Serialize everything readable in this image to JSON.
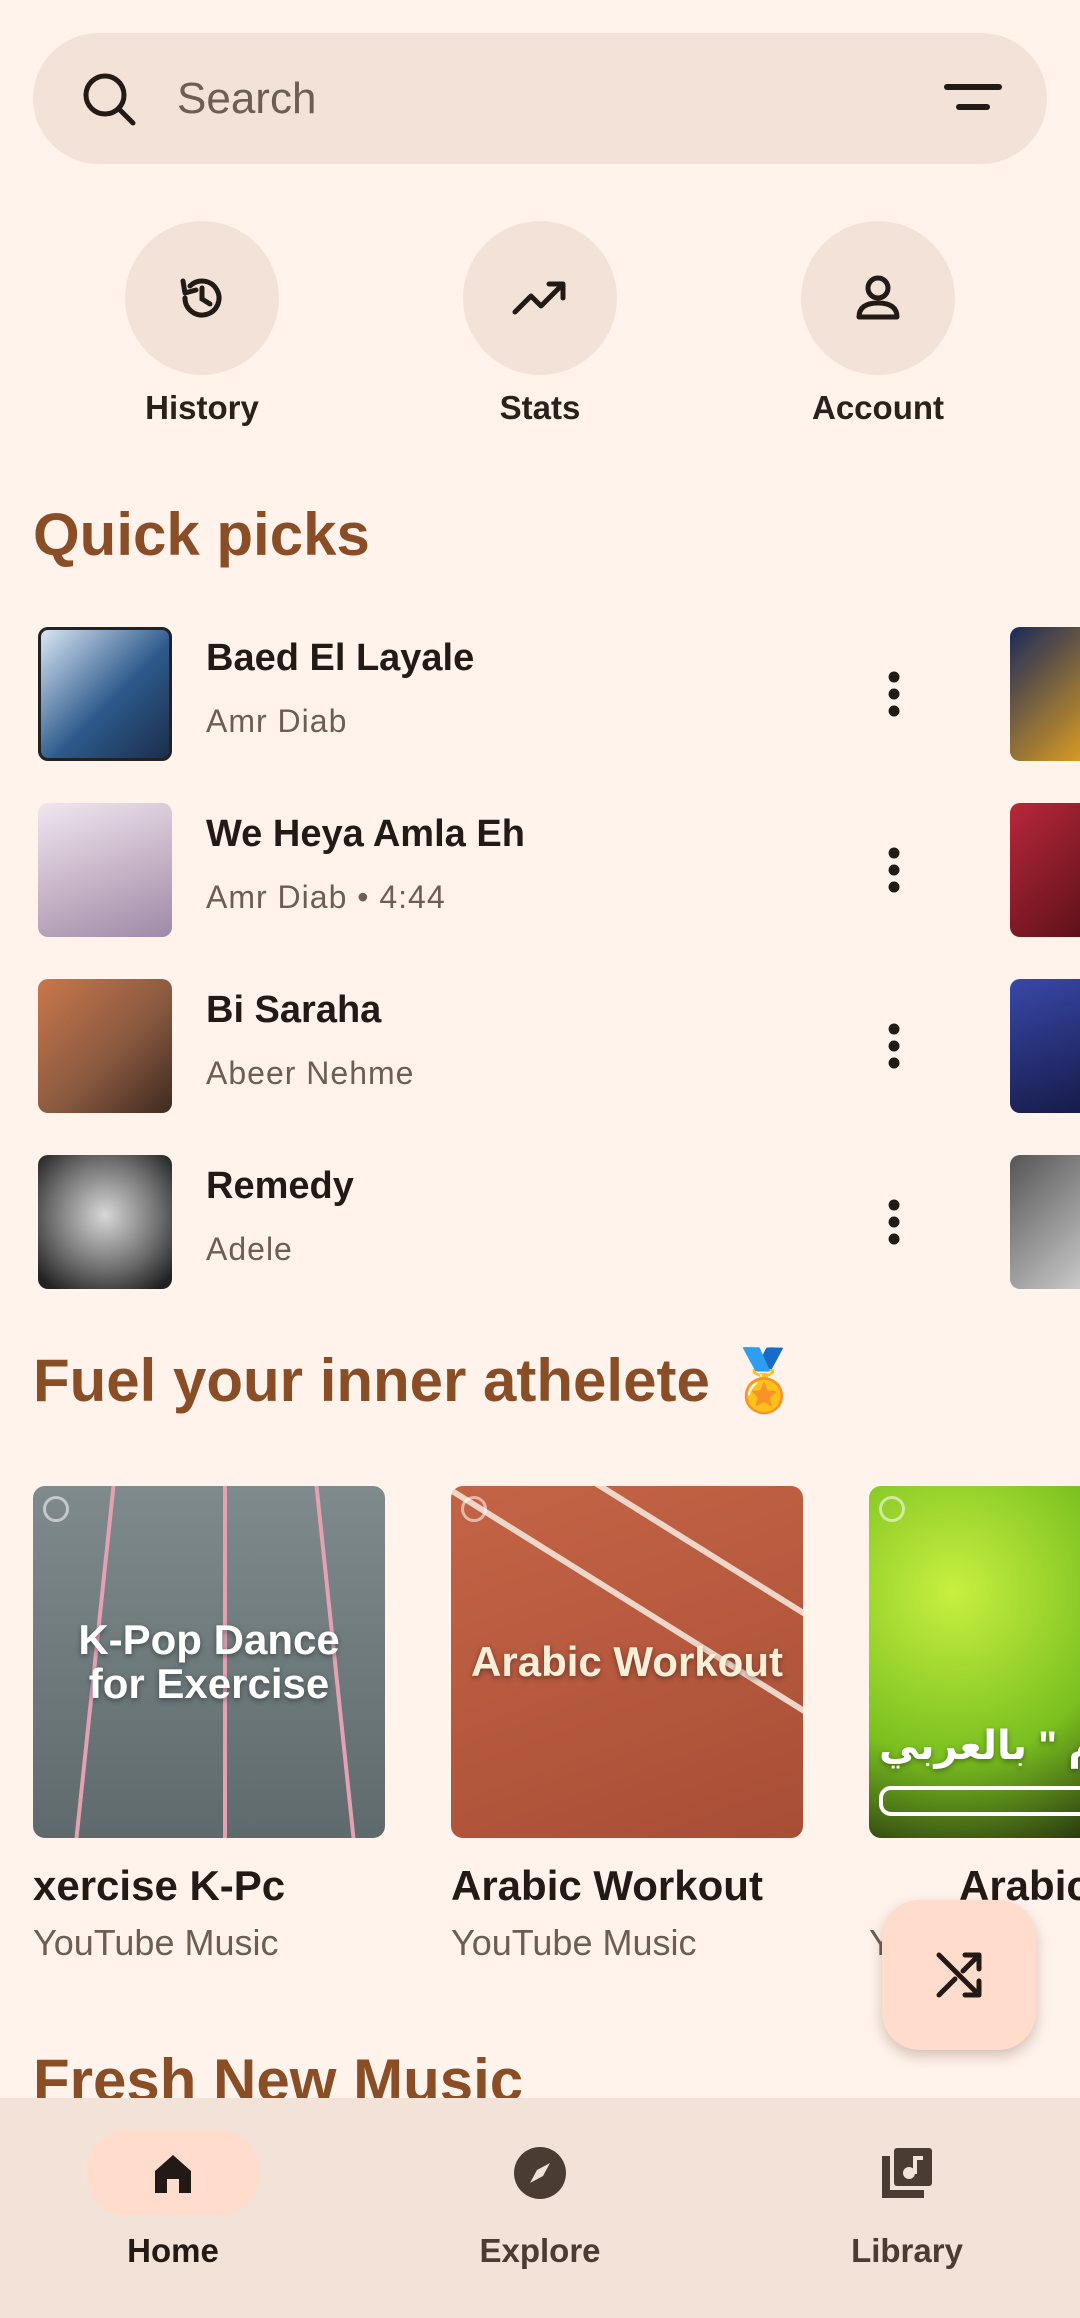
{
  "search": {
    "placeholder": "Search",
    "icon": "search-icon",
    "filter_icon": "filter-icon"
  },
  "shortcuts": [
    {
      "label": "History",
      "icon": "history-icon"
    },
    {
      "label": "Stats",
      "icon": "trending-up-icon"
    },
    {
      "label": "Account",
      "icon": "person-icon"
    }
  ],
  "quick_picks": {
    "title": "Quick picks",
    "items": [
      {
        "title": "Baed El Layale",
        "subtitle": "Amr Diab",
        "color": "#2E5A8C"
      },
      {
        "title": "We Heya Amla Eh",
        "subtitle": "Amr Diab • 4:44",
        "color": "#C9B7C9"
      },
      {
        "title": "Bi Saraha",
        "subtitle": "Abeer Nehme",
        "color": "#8A5A40"
      },
      {
        "title": "Remedy",
        "subtitle": "Adele",
        "color": "#3B3B3B"
      }
    ]
  },
  "athlete": {
    "title": "Fuel your inner athelete 🏅",
    "cards": [
      {
        "art_text": "K-Pop Dance for Exercise",
        "caption": "xercise          K-Pc",
        "subtitle": "YouTube Music"
      },
      {
        "art_text": "Arabic Workout",
        "caption": "Arabic Workout",
        "subtitle": "YouTube Music"
      },
      {
        "art_text": "إم \" بالعربي",
        "caption": "Arabic",
        "subtitle": "Y       Mu"
      }
    ]
  },
  "fresh": {
    "title": "Fresh New Music"
  },
  "fab": {
    "icon": "shuffle-icon"
  },
  "nav": {
    "items": [
      {
        "label": "Home",
        "icon": "home-icon",
        "active": true
      },
      {
        "label": "Explore",
        "icon": "compass-icon",
        "active": false
      },
      {
        "label": "Library",
        "icon": "library-icon",
        "active": false
      }
    ]
  },
  "colors": {
    "accent": "#8A4E27",
    "surface": "#F3E2D8",
    "background": "#FFF3EC",
    "active_pill": "#FFDCCB"
  }
}
